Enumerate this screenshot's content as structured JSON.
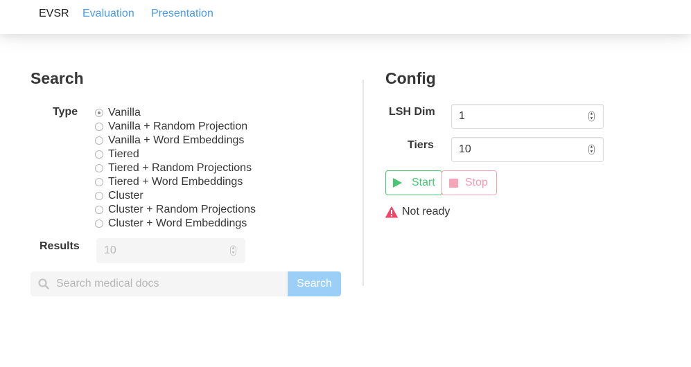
{
  "nav": {
    "brand": "EVSR",
    "links": [
      "Evaluation",
      "Presentation"
    ]
  },
  "search_panel": {
    "title": "Search",
    "type_label": "Type",
    "options": [
      "Vanilla",
      "Vanilla + Random Projection",
      "Vanilla + Word Embeddings",
      "Tiered",
      "Tiered + Random Projections",
      "Tiered + Word Embeddings",
      "Cluster",
      "Cluster + Random Projections",
      "Cluster + Word Embeddings"
    ],
    "selected_option": "Vanilla",
    "results_label": "Results",
    "results_value": "10",
    "search_placeholder": "Search medical docs",
    "search_button": "Search"
  },
  "config_panel": {
    "title": "Config",
    "lsh_label": "LSH Dim",
    "lsh_value": "1",
    "tiers_label": "Tiers",
    "tiers_value": "10",
    "start_label": "Start",
    "stop_label": "Stop",
    "status_text": "Not ready",
    "status_icon": "warning-icon"
  },
  "colors": {
    "link": "#4a9be8",
    "success": "#48c774",
    "danger": "#f14668",
    "info_light": "#9ccff7"
  }
}
